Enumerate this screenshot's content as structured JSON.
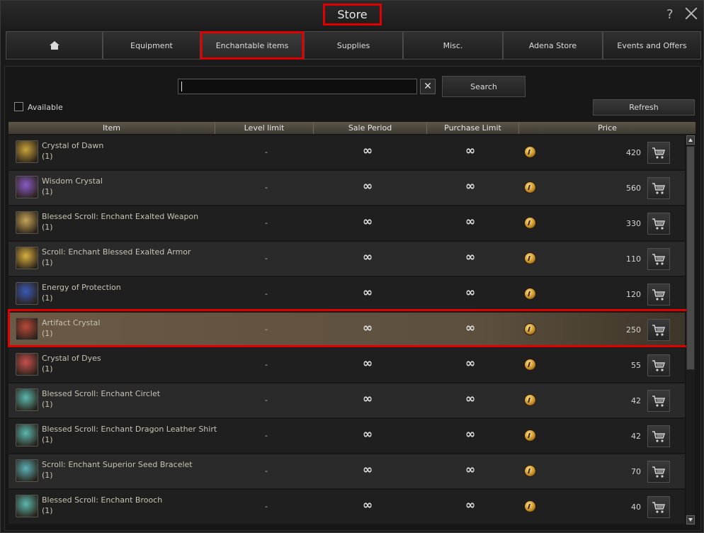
{
  "window": {
    "title": "Store",
    "help": "?"
  },
  "tabs": [
    {
      "label": "",
      "icon": "home-icon"
    },
    {
      "label": "Equipment"
    },
    {
      "label": "Enchantable items",
      "active": true
    },
    {
      "label": "Supplies"
    },
    {
      "label": "Misc."
    },
    {
      "label": "Adena Store"
    },
    {
      "label": "Events and Offers"
    }
  ],
  "search": {
    "value": "",
    "clear": "✕",
    "button": "Search"
  },
  "filter": {
    "available_label": "Available",
    "refresh_label": "Refresh"
  },
  "table": {
    "headers": [
      "Item",
      "Level limit",
      "Sale Period",
      "Purchase Limit",
      "Price"
    ],
    "rows": [
      {
        "name": "Crystal of Dawn",
        "qty": "(1)",
        "level": "-",
        "sale": "∞",
        "limit": "∞",
        "price": "420",
        "icon_color": "#c9a23a"
      },
      {
        "name": "Wisdom Crystal",
        "qty": "(1)",
        "level": "-",
        "sale": "∞",
        "limit": "∞",
        "price": "560",
        "icon_color": "#8a5ac8"
      },
      {
        "name": "Blessed Scroll: Enchant Exalted Weapon",
        "qty": "(1)",
        "level": "-",
        "sale": "∞",
        "limit": "∞",
        "price": "330",
        "icon_color": "#c8a45a"
      },
      {
        "name": "Scroll: Enchant Blessed Exalted Armor",
        "qty": "(1)",
        "level": "-",
        "sale": "∞",
        "limit": "∞",
        "price": "110",
        "icon_color": "#d8b040"
      },
      {
        "name": "Energy of Protection",
        "qty": "(1)",
        "level": "-",
        "sale": "∞",
        "limit": "∞",
        "price": "120",
        "icon_color": "#3a5ab8"
      },
      {
        "name": "Artifact Crystal",
        "qty": "(1)",
        "level": "-",
        "sale": "∞",
        "limit": "∞",
        "price": "250",
        "icon_color": "#b84a3a",
        "selected": true
      },
      {
        "name": "Crystal of Dyes",
        "qty": "(1)",
        "level": "-",
        "sale": "∞",
        "limit": "∞",
        "price": "55",
        "icon_color": "#c85050"
      },
      {
        "name": "Blessed Scroll: Enchant Circlet",
        "qty": "(1)",
        "level": "-",
        "sale": "∞",
        "limit": "∞",
        "price": "42",
        "icon_color": "#5ab8b0"
      },
      {
        "name": "Blessed Scroll: Enchant Dragon Leather Shirt",
        "qty": "(1)",
        "level": "-",
        "sale": "∞",
        "limit": "∞",
        "price": "42",
        "icon_color": "#5ab8b0"
      },
      {
        "name": "Scroll: Enchant Superior Seed Bracelet",
        "qty": "(1)",
        "level": "-",
        "sale": "∞",
        "limit": "∞",
        "price": "70",
        "icon_color": "#5ab0b8"
      },
      {
        "name": "Blessed Scroll: Enchant Brooch",
        "qty": "(1)",
        "level": "-",
        "sale": "∞",
        "limit": "∞",
        "price": "40",
        "icon_color": "#5ab8b0"
      }
    ]
  },
  "colors": {
    "highlight": "#e00000",
    "selected_row": "#6a5a45",
    "header": "#5c5548"
  }
}
